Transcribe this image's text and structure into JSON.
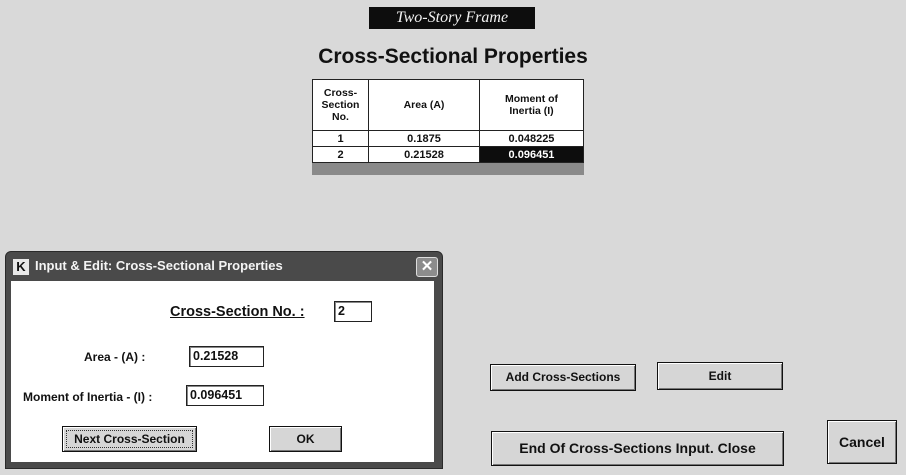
{
  "window_title": "Two-Story Frame",
  "heading": "Cross-Sectional Properties",
  "grid": {
    "headers": [
      [
        "Cross-",
        "Section",
        "No."
      ],
      [
        "Area (A)"
      ],
      [
        "Moment of",
        "Inertia (I)"
      ]
    ],
    "rows": [
      [
        "1",
        "0.1875",
        "0.048225"
      ],
      [
        "2",
        "0.21528",
        "0.096451"
      ]
    ]
  },
  "dialog": {
    "logo_letter": "K",
    "title": "Input & Edit: Cross-Sectional Properties",
    "close_glyph": "✕",
    "section_no_label": "Cross-Section No. :",
    "section_no_value": "2",
    "area_label": "Area -  (A)  :",
    "area_value": "0.21528",
    "moment_label": "Moment of Inertia - (I) :",
    "moment_value": "0.096451",
    "next_button": "Next Cross-Section",
    "ok_button": "OK"
  },
  "buttons": {
    "add": "Add Cross-Sections",
    "edit": "Edit",
    "end": "End Of Cross-Sections Input. Close",
    "cancel": "Cancel"
  },
  "colors": {
    "background": "#d9d9d9",
    "selected_cell": "#0d0d0d",
    "dialog_frame": "#4a4a4a"
  }
}
